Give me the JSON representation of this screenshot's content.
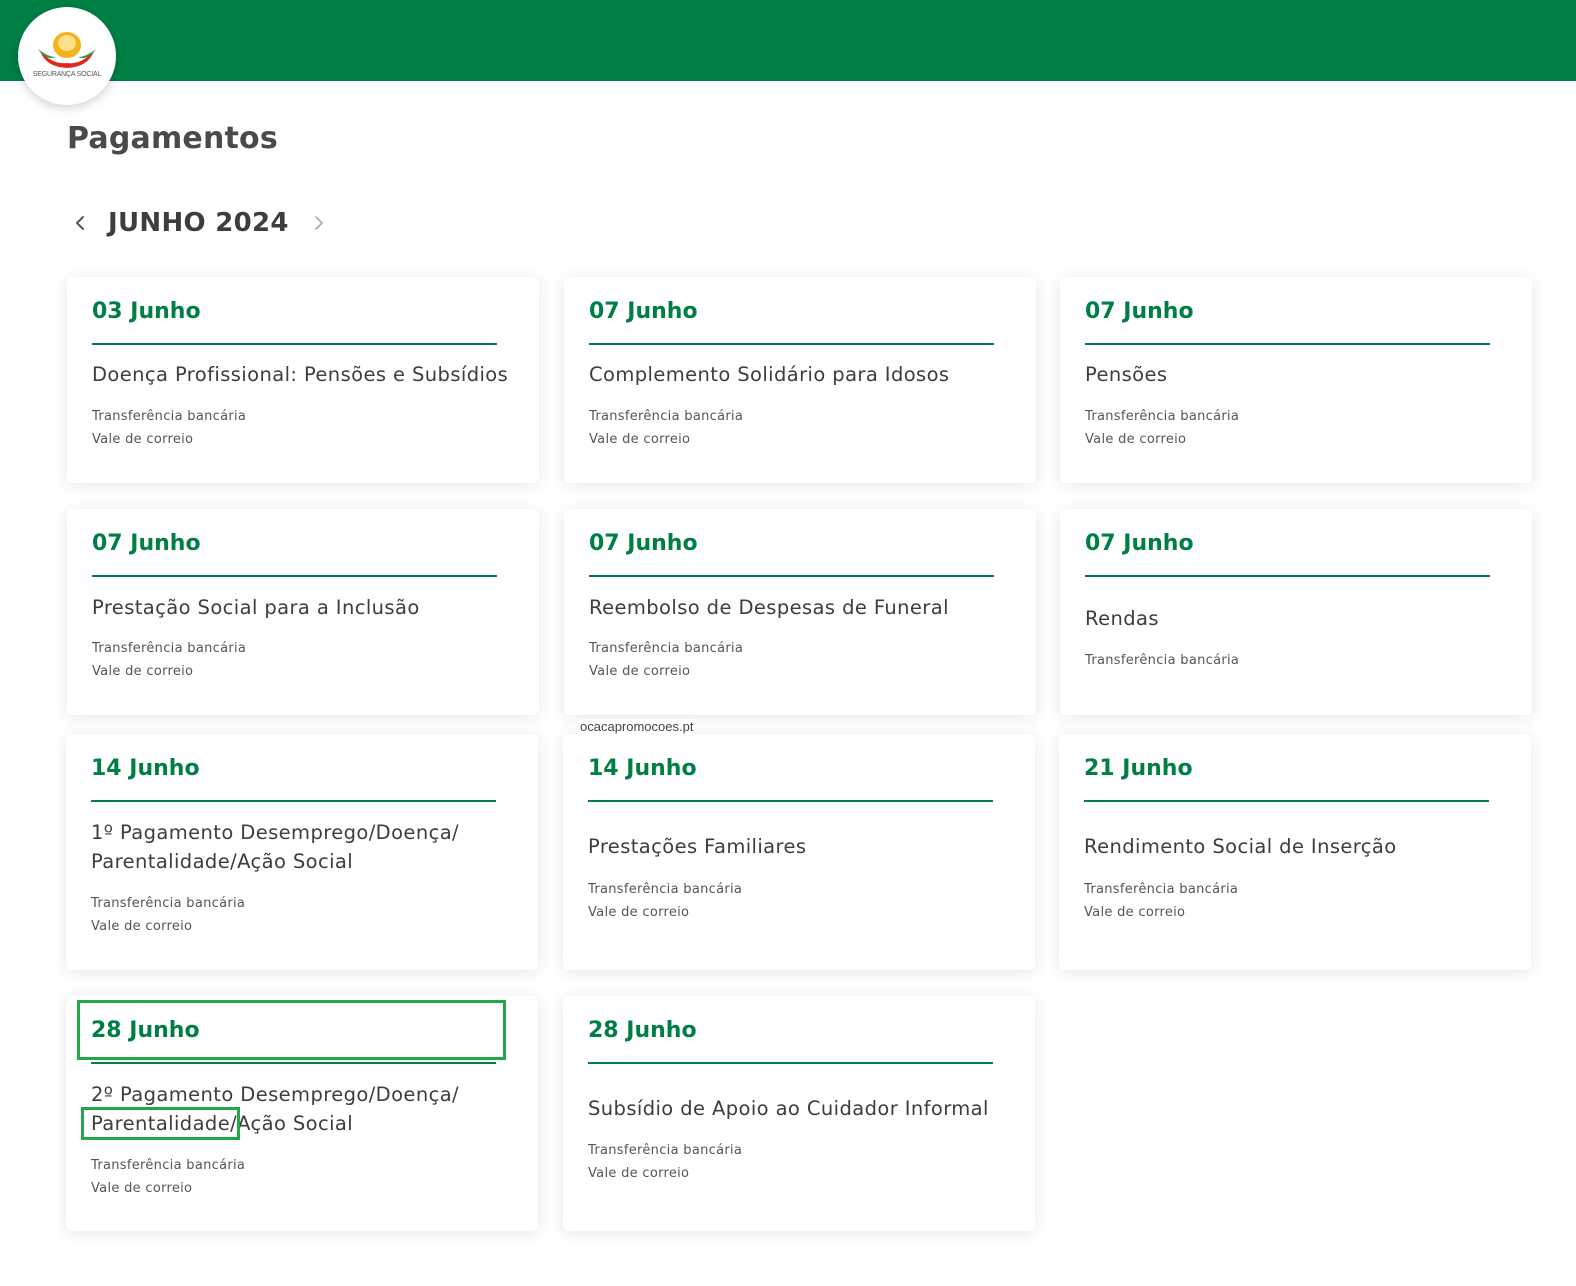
{
  "header": {
    "logo_text": "SEGURANÇA SOCIAL",
    "color": "#007f45"
  },
  "page": {
    "title": "Pagamentos",
    "month": "JUNHO 2024",
    "prev_icon": "chevron-left-icon",
    "next_icon": "chevron-right-icon"
  },
  "watermark": "ocacapromocoes.pt",
  "cards": [
    {
      "date": "03 Junho",
      "title": "Doença Profissional: Pensões e Subsídios",
      "methods": [
        "Transferência bancária",
        "Vale de correio"
      ]
    },
    {
      "date": "07 Junho",
      "title": "Complemento Solidário para Idosos",
      "methods": [
        "Transferência bancária",
        "Vale de correio"
      ]
    },
    {
      "date": "07 Junho",
      "title": "Pensões",
      "methods": [
        "Transferência bancária",
        "Vale de correio"
      ]
    },
    {
      "date": "07 Junho",
      "title": "Prestação Social para a Inclusão",
      "methods": [
        "Transferência bancária",
        "Vale de correio"
      ]
    },
    {
      "date": "07 Junho",
      "title": "Reembolso de Despesas de Funeral",
      "methods": [
        "Transferência bancária",
        "Vale de correio"
      ]
    },
    {
      "date": "07 Junho",
      "title": "Rendas",
      "methods": [
        "Transferência bancária"
      ]
    },
    {
      "date": "14 Junho",
      "title": "1º Pagamento Desemprego/Doença/ Parentalidade/Ação Social",
      "methods": [
        "Transferência bancária",
        "Vale de correio"
      ]
    },
    {
      "date": "14 Junho",
      "title": "Prestações Familiares",
      "methods": [
        "Transferência bancária",
        "Vale de correio"
      ]
    },
    {
      "date": "21 Junho",
      "title": "Rendimento Social de Inserção",
      "methods": [
        "Transferência bancária",
        "Vale de correio"
      ]
    },
    {
      "date": "28 Junho",
      "title": "2º Pagamento Desemprego/Doença/ Parentalidade/Ação Social",
      "methods": [
        "Transferência bancária",
        "Vale de correio"
      ]
    },
    {
      "date": "28 Junho",
      "title": "Subsídio de Apoio ao Cuidador Informal",
      "methods": [
        "Transferência bancária",
        "Vale de correio"
      ]
    }
  ]
}
